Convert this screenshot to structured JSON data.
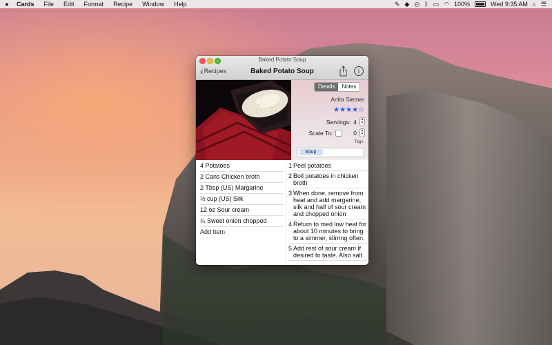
{
  "menubar": {
    "app_name": "Cards",
    "menus": [
      "File",
      "Edit",
      "Format",
      "Recipe",
      "Window",
      "Help"
    ],
    "battery_text": "100%",
    "clock": "Wed 9:35 AM"
  },
  "window": {
    "title": "Baked Potato Soup",
    "back_label": "Recipes",
    "nav_title": "Baked Potato Soup"
  },
  "details": {
    "tab_details": "Details",
    "tab_notes": "Notes",
    "selected_tab": "Details",
    "author": "Anita Siemer",
    "rating": 4,
    "rating_max": 5,
    "stars_text": "★★★★☆",
    "servings_label": "Servings:",
    "servings_value": "4",
    "scale_label": "Scale To:",
    "scale_value": "0",
    "tags_label": "Tags:",
    "tag": "Soup"
  },
  "ingredients": [
    "4 Potatoes",
    "2 Cans Chicken broth",
    "2 Tbsp (US) Margarine",
    "½ cup (US) Silk",
    "12 oz Sour cream",
    "¼ Sweet onion chopped"
  ],
  "add_item_label": "Add Item",
  "directions": [
    {
      "num": "1",
      "text": "Peel potatoes"
    },
    {
      "num": "2",
      "text": "Boil potatoes in chicken broth"
    },
    {
      "num": "3",
      "text": "When done, remove from heat and add margarine, silk and half of sour cream and chopped onion"
    },
    {
      "num": "4",
      "text": "Return to med low heat for about 10 minutes to bring to a simmer, stirring often."
    },
    {
      "num": "5",
      "text": "Add rest of sour cream if desired to taste. Also salt"
    }
  ],
  "colors": {
    "star_blue": "#2f5de8",
    "tag_chip": "#cde0f4",
    "close": "#fc5b57",
    "minimize": "#e5bf3c",
    "maximize": "#57c038"
  }
}
